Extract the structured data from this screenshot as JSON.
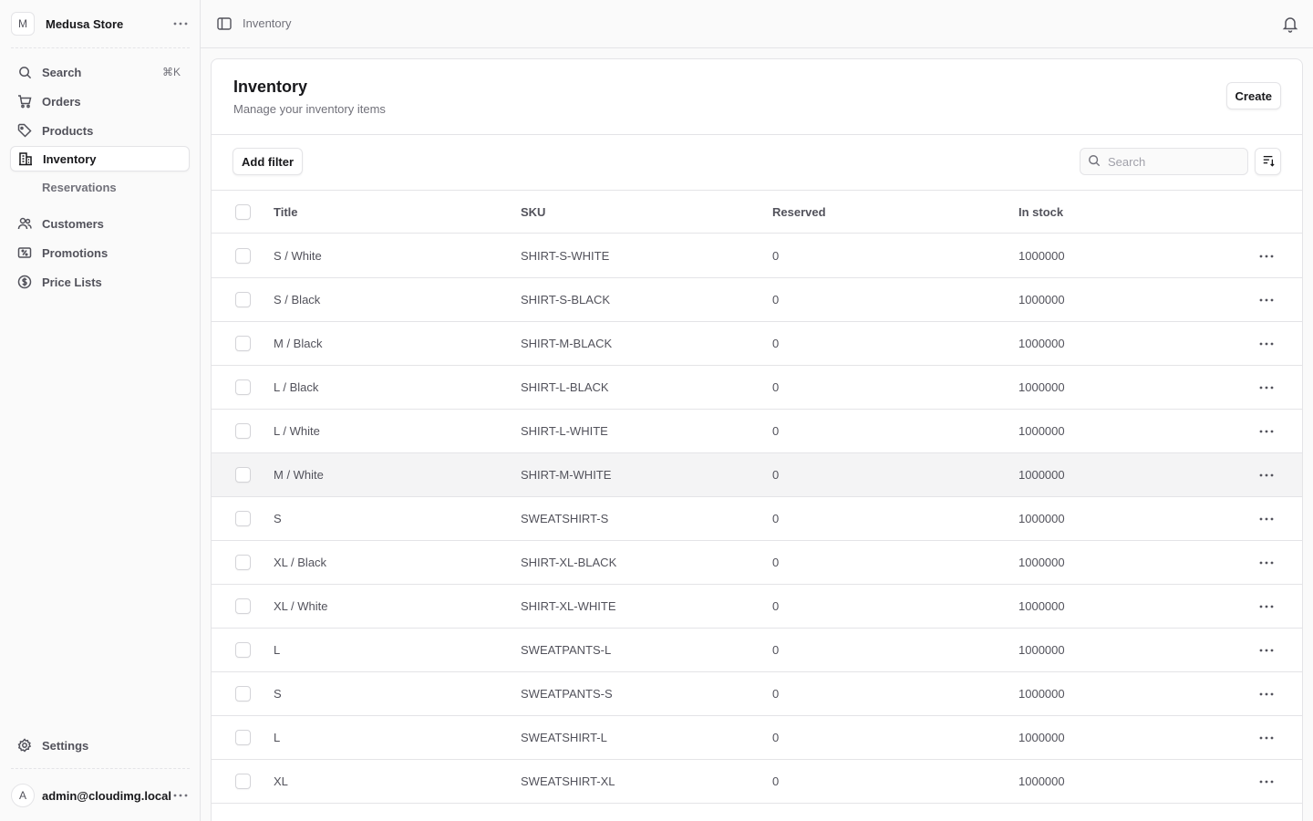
{
  "sidebar": {
    "store_initial": "M",
    "store_name": "Medusa Store",
    "search_label": "Search",
    "search_shortcut": "⌘K",
    "items": [
      {
        "label": "Orders"
      },
      {
        "label": "Products"
      },
      {
        "label": "Inventory"
      },
      {
        "label": "Reservations"
      },
      {
        "label": "Customers"
      },
      {
        "label": "Promotions"
      },
      {
        "label": "Price Lists"
      }
    ],
    "settings_label": "Settings",
    "user_initial": "A",
    "user_email": "admin@cloudimg.local"
  },
  "topbar": {
    "breadcrumb": "Inventory"
  },
  "page": {
    "title": "Inventory",
    "subtitle": "Manage your inventory items",
    "create_label": "Create",
    "add_filter_label": "Add filter",
    "search_placeholder": "Search"
  },
  "table": {
    "columns": [
      "Title",
      "SKU",
      "Reserved",
      "In stock"
    ],
    "rows": [
      {
        "title": "S / White",
        "sku": "SHIRT-S-WHITE",
        "reserved": "0",
        "in_stock": "1000000"
      },
      {
        "title": "S / Black",
        "sku": "SHIRT-S-BLACK",
        "reserved": "0",
        "in_stock": "1000000"
      },
      {
        "title": "M / Black",
        "sku": "SHIRT-M-BLACK",
        "reserved": "0",
        "in_stock": "1000000"
      },
      {
        "title": "L / Black",
        "sku": "SHIRT-L-BLACK",
        "reserved": "0",
        "in_stock": "1000000"
      },
      {
        "title": "L / White",
        "sku": "SHIRT-L-WHITE",
        "reserved": "0",
        "in_stock": "1000000"
      },
      {
        "title": "M / White",
        "sku": "SHIRT-M-WHITE",
        "reserved": "0",
        "in_stock": "1000000"
      },
      {
        "title": "S",
        "sku": "SWEATSHIRT-S",
        "reserved": "0",
        "in_stock": "1000000"
      },
      {
        "title": "XL / Black",
        "sku": "SHIRT-XL-BLACK",
        "reserved": "0",
        "in_stock": "1000000"
      },
      {
        "title": "XL / White",
        "sku": "SHIRT-XL-WHITE",
        "reserved": "0",
        "in_stock": "1000000"
      },
      {
        "title": "L",
        "sku": "SWEATPANTS-L",
        "reserved": "0",
        "in_stock": "1000000"
      },
      {
        "title": "S",
        "sku": "SWEATPANTS-S",
        "reserved": "0",
        "in_stock": "1000000"
      },
      {
        "title": "L",
        "sku": "SWEATSHIRT-L",
        "reserved": "0",
        "in_stock": "1000000"
      },
      {
        "title": "XL",
        "sku": "SWEATSHIRT-XL",
        "reserved": "0",
        "in_stock": "1000000"
      }
    ]
  }
}
